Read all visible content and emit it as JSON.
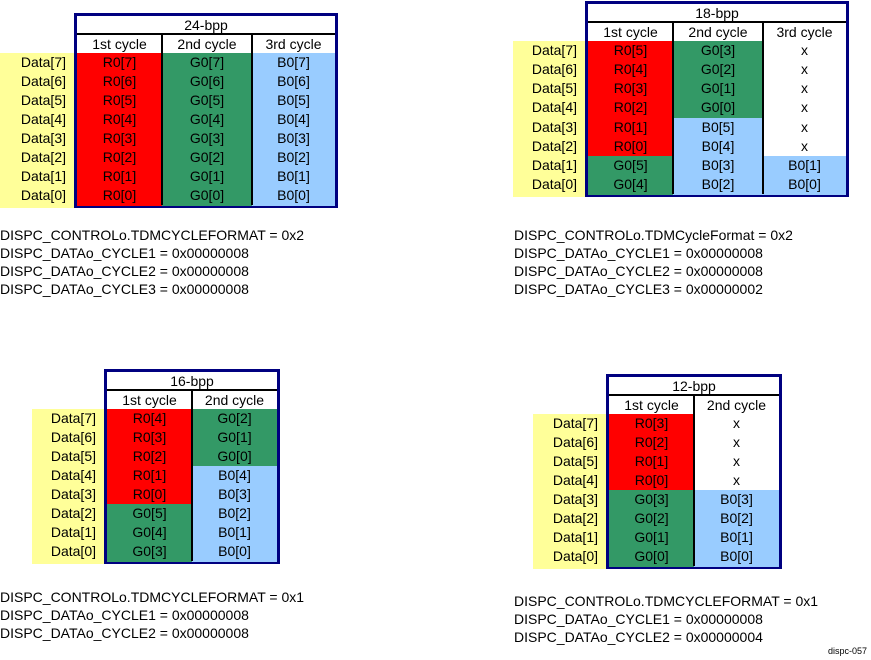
{
  "colors": {
    "red": "#ff0000",
    "green": "#339966",
    "blue": "#99ccff",
    "white": "#ffffff",
    "label_bg": "#ffff99",
    "border": "#000080"
  },
  "row_labels": [
    "Data[7]",
    "Data[6]",
    "Data[5]",
    "Data[4]",
    "Data[3]",
    "Data[2]",
    "Data[1]",
    "Data[0]"
  ],
  "figure_id": "dispc-057",
  "panels": [
    {
      "title": "24-bpp",
      "columns": [
        "1st cycle",
        "2nd cycle",
        "3rd cycle"
      ],
      "cells": [
        [
          {
            "t": "R0[7]",
            "c": "red"
          },
          {
            "t": "G0[7]",
            "c": "green"
          },
          {
            "t": "B0[7]",
            "c": "blue"
          }
        ],
        [
          {
            "t": "R0[6]",
            "c": "red"
          },
          {
            "t": "G0[6]",
            "c": "green"
          },
          {
            "t": "B0[6]",
            "c": "blue"
          }
        ],
        [
          {
            "t": "R0[5]",
            "c": "red"
          },
          {
            "t": "G0[5]",
            "c": "green"
          },
          {
            "t": "B0[5]",
            "c": "blue"
          }
        ],
        [
          {
            "t": "R0[4]",
            "c": "red"
          },
          {
            "t": "G0[4]",
            "c": "green"
          },
          {
            "t": "B0[4]",
            "c": "blue"
          }
        ],
        [
          {
            "t": "R0[3]",
            "c": "red"
          },
          {
            "t": "G0[3]",
            "c": "green"
          },
          {
            "t": "B0[3]",
            "c": "blue"
          }
        ],
        [
          {
            "t": "R0[2]",
            "c": "red"
          },
          {
            "t": "G0[2]",
            "c": "green"
          },
          {
            "t": "B0[2]",
            "c": "blue"
          }
        ],
        [
          {
            "t": "R0[1]",
            "c": "red"
          },
          {
            "t": "G0[1]",
            "c": "green"
          },
          {
            "t": "B0[1]",
            "c": "blue"
          }
        ],
        [
          {
            "t": "R0[0]",
            "c": "red"
          },
          {
            "t": "G0[0]",
            "c": "green"
          },
          {
            "t": "B0[0]",
            "c": "blue"
          }
        ]
      ],
      "registers": [
        "DISPC_CONTROLo.TDMCYCLEFORMAT = 0x2",
        "DISPC_DATAo_CYCLE1 = 0x00000008",
        "DISPC_DATAo_CYCLE2 = 0x00000008",
        "DISPC_DATAo_CYCLE3 = 0x00000008"
      ]
    },
    {
      "title": "18-bpp",
      "columns": [
        "1st cycle",
        "2nd cycle",
        "3rd cycle"
      ],
      "cells": [
        [
          {
            "t": "R0[5]",
            "c": "red"
          },
          {
            "t": "G0[3]",
            "c": "green"
          },
          {
            "t": "x",
            "c": "white"
          }
        ],
        [
          {
            "t": "R0[4]",
            "c": "red"
          },
          {
            "t": "G0[2]",
            "c": "green"
          },
          {
            "t": "x",
            "c": "white"
          }
        ],
        [
          {
            "t": "R0[3]",
            "c": "red"
          },
          {
            "t": "G0[1]",
            "c": "green"
          },
          {
            "t": "x",
            "c": "white"
          }
        ],
        [
          {
            "t": "R0[2]",
            "c": "red"
          },
          {
            "t": "G0[0]",
            "c": "green"
          },
          {
            "t": "x",
            "c": "white"
          }
        ],
        [
          {
            "t": "R0[1]",
            "c": "red"
          },
          {
            "t": "B0[5]",
            "c": "blue"
          },
          {
            "t": "x",
            "c": "white"
          }
        ],
        [
          {
            "t": "R0[0]",
            "c": "red"
          },
          {
            "t": "B0[4]",
            "c": "blue"
          },
          {
            "t": "x",
            "c": "white"
          }
        ],
        [
          {
            "t": "G0[5]",
            "c": "green"
          },
          {
            "t": "B0[3]",
            "c": "blue"
          },
          {
            "t": "B0[1]",
            "c": "blue"
          }
        ],
        [
          {
            "t": "G0[4]",
            "c": "green"
          },
          {
            "t": "B0[2]",
            "c": "blue"
          },
          {
            "t": "B0[0]",
            "c": "blue"
          }
        ]
      ],
      "registers": [
        "DISPC_CONTROLo.TDMCycleFormat = 0x2",
        "DISPC_DATAo_CYCLE1 = 0x00000008",
        "DISPC_DATAo_CYCLE2 = 0x00000008",
        "DISPC_DATAo_CYCLE3 = 0x00000002"
      ]
    },
    {
      "title": "16-bpp",
      "columns": [
        "1st cycle",
        "2nd cycle"
      ],
      "cells": [
        [
          {
            "t": "R0[4]",
            "c": "red"
          },
          {
            "t": "G0[2]",
            "c": "green"
          }
        ],
        [
          {
            "t": "R0[3]",
            "c": "red"
          },
          {
            "t": "G0[1]",
            "c": "green"
          }
        ],
        [
          {
            "t": "R0[2]",
            "c": "red"
          },
          {
            "t": "G0[0]",
            "c": "green"
          }
        ],
        [
          {
            "t": "R0[1]",
            "c": "red"
          },
          {
            "t": "B0[4]",
            "c": "blue"
          }
        ],
        [
          {
            "t": "R0[0]",
            "c": "red"
          },
          {
            "t": "B0[3]",
            "c": "blue"
          }
        ],
        [
          {
            "t": "G0[5]",
            "c": "green"
          },
          {
            "t": "B0[2]",
            "c": "blue"
          }
        ],
        [
          {
            "t": "G0[4]",
            "c": "green"
          },
          {
            "t": "B0[1]",
            "c": "blue"
          }
        ],
        [
          {
            "t": "G0[3]",
            "c": "green"
          },
          {
            "t": "B0[0]",
            "c": "blue"
          }
        ]
      ],
      "registers": [
        "DISPC_CONTROLo.TDMCYCLEFORMAT = 0x1",
        "DISPC_DATAo_CYCLE1 = 0x00000008",
        "DISPC_DATAo_CYCLE2 = 0x00000008"
      ]
    },
    {
      "title": "12-bpp",
      "columns": [
        "1st cycle",
        "2nd cycle"
      ],
      "cells": [
        [
          {
            "t": "R0[3]",
            "c": "red"
          },
          {
            "t": "x",
            "c": "white"
          }
        ],
        [
          {
            "t": "R0[2]",
            "c": "red"
          },
          {
            "t": "x",
            "c": "white"
          }
        ],
        [
          {
            "t": "R0[1]",
            "c": "red"
          },
          {
            "t": "x",
            "c": "white"
          }
        ],
        [
          {
            "t": "R0[0]",
            "c": "red"
          },
          {
            "t": "x",
            "c": "white"
          }
        ],
        [
          {
            "t": "G0[3]",
            "c": "green"
          },
          {
            "t": "B0[3]",
            "c": "blue"
          }
        ],
        [
          {
            "t": "G0[2]",
            "c": "green"
          },
          {
            "t": "B0[2]",
            "c": "blue"
          }
        ],
        [
          {
            "t": "G0[1]",
            "c": "green"
          },
          {
            "t": "B0[1]",
            "c": "blue"
          }
        ],
        [
          {
            "t": "G0[0]",
            "c": "green"
          },
          {
            "t": "B0[0]",
            "c": "blue"
          }
        ]
      ],
      "registers": [
        "DISPC_CONTROLo.TDMCYCLEFORMAT = 0x1",
        "DISPC_DATAo_CYCLE1 = 0x00000008",
        "DISPC_DATAo_CYCLE2 = 0x00000004"
      ]
    }
  ]
}
